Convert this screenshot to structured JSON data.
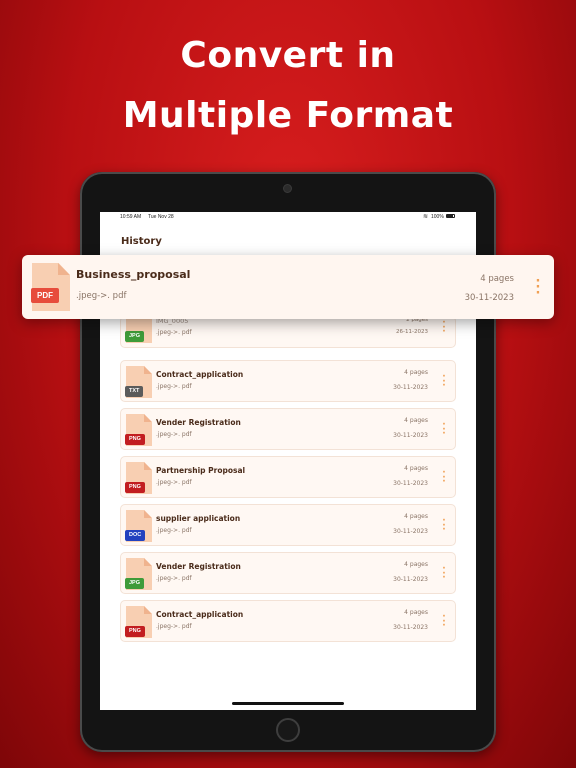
{
  "headline": {
    "line1": "Convert in",
    "line2": "Multiple Format"
  },
  "status_bar": {
    "time": "10:59 AM",
    "date": "Tue Nov 28",
    "battery": "100%"
  },
  "screen": {
    "title": "History"
  },
  "featured": {
    "name": "Business_proposal",
    "badge": "PDF",
    "conversion": ".jpeg->. pdf",
    "pages": "4 pages",
    "date": "30-11-2023"
  },
  "history": [
    {
      "name": "IMG_0005",
      "badge": "JPG",
      "type": "jpg",
      "conversion": ".jpeg->. pdf",
      "pages": "2 pages",
      "date": "26-11-2023"
    },
    {
      "name": "Contract_application",
      "badge": "TXT",
      "type": "txt",
      "conversion": ".jpeg->. pdf",
      "pages": "4 pages",
      "date": "30-11-2023"
    },
    {
      "name": "Vender Registration",
      "badge": "PNG",
      "type": "png",
      "conversion": ".jpeg->. pdf",
      "pages": "4 pages",
      "date": "30-11-2023"
    },
    {
      "name": "Partnership Proposal",
      "badge": "PNG",
      "type": "png",
      "conversion": ".jpeg->. pdf",
      "pages": "4 pages",
      "date": "30-11-2023"
    },
    {
      "name": "supplier application",
      "badge": "DOC",
      "type": "doc",
      "conversion": ".jpeg->. pdf",
      "pages": "4 pages",
      "date": "30-11-2023"
    },
    {
      "name": "Vender Registration",
      "badge": "JPG",
      "type": "jpg",
      "conversion": ".jpeg->. pdf",
      "pages": "4 pages",
      "date": "30-11-2023"
    },
    {
      "name": "Contract_application",
      "badge": "PNG",
      "type": "png",
      "conversion": ".jpeg->. pdf",
      "pages": "4 pages",
      "date": "30-11-2023"
    }
  ],
  "icons": {
    "file": "document-icon",
    "menu": "more-vertical-icon",
    "wifi": "wifi-icon",
    "battery": "battery-icon"
  },
  "colors": {
    "background": "#c8161a",
    "accent": "#f0a055",
    "card": "#fff8f3"
  }
}
